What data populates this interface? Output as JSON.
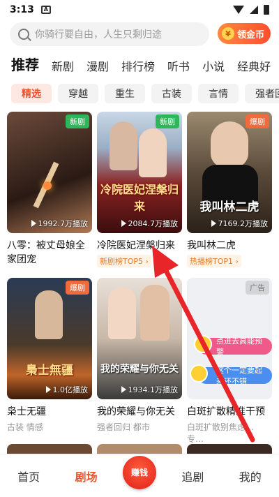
{
  "status": {
    "time": "3:13"
  },
  "search": {
    "placeholder": "你骑行要自由，人生只剩归途",
    "coin_button": "领金币"
  },
  "tabs": [
    "推荐",
    "新剧",
    "漫剧",
    "排行榜",
    "听书",
    "小说",
    "经典好"
  ],
  "chips": [
    "精选",
    "穿越",
    "重生",
    "古装",
    "言情",
    "强者回"
  ],
  "cards": [
    {
      "title": "八零：被丈母娘全家团宠",
      "plays": "1992.7万播放",
      "badge": "新剧"
    },
    {
      "title": "冷院医妃涅槃归来",
      "plays": "2084.7万播放",
      "badge": "新剧",
      "rank": "新剧榜TOP5",
      "poster_text": "冷院医妃涅槃归来"
    },
    {
      "title": "我叫林二虎",
      "plays": "7169.2万播放",
      "badge": "爆剧",
      "rank": "热播榜TOP1",
      "poster_text": "我叫林二虎"
    },
    {
      "title": "枭士无疆",
      "plays": "1.0亿播放",
      "badge": "爆剧",
      "sub": "古装 情感",
      "poster_text": "梟士無疆"
    },
    {
      "title": "我的荣耀与你无关",
      "plays": "1934.1万播放",
      "sub": "强者回归 都市",
      "poster_text": "我的荣耀与你无关"
    },
    {
      "title": "白斑扩散精准干预",
      "badge": "广告",
      "sub": "白斑扩散别焦虑…",
      "more": "专…",
      "bubble1": "点进去高能预警",
      "bubble2": "这个一定要起来还不错"
    }
  ],
  "nav": [
    "首页",
    "剧场",
    "赚钱",
    "追剧",
    "我的"
  ],
  "colors": {
    "accent": "#f0532b",
    "new_badge": "#2fb55a",
    "hot_badge": "#f06a3c"
  }
}
